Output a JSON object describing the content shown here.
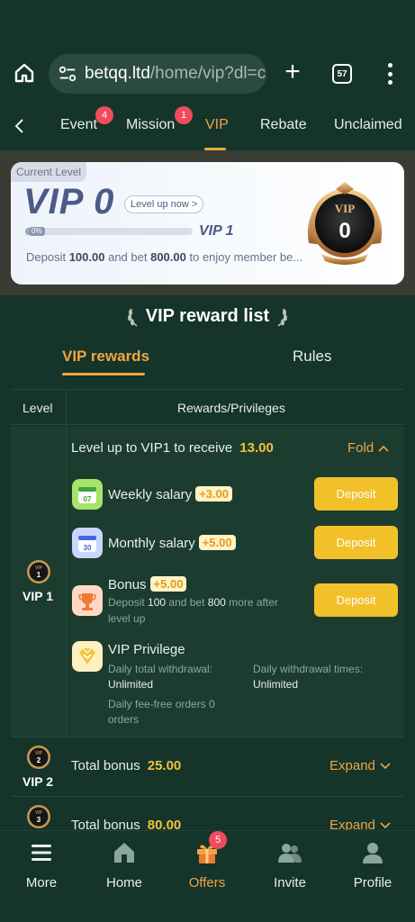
{
  "browser": {
    "url_domain": "betqq.ltd",
    "url_path": "/home/vip?dl=c",
    "tab_count": "57"
  },
  "nav": {
    "tabs": [
      {
        "label": "Event",
        "badge": "4"
      },
      {
        "label": "Mission",
        "badge": "1"
      },
      {
        "label": "VIP",
        "badge": ""
      },
      {
        "label": "Rebate",
        "badge": ""
      },
      {
        "label": "Unclaimed",
        "badge": ""
      }
    ],
    "active_tab": "VIP"
  },
  "level_card": {
    "current_level_label": "Current Level",
    "current_vip": "VIP 0",
    "level_up_label": "Level up now >",
    "progress_label": "0%",
    "progress_fraction": 0,
    "next_vip": "VIP 1",
    "desc_prefix": "Deposit",
    "deposit_amount": "100.00",
    "desc_mid": "and bet",
    "bet_amount": "800.00",
    "desc_suffix": "to enjoy member be...",
    "medal_title": "VIP",
    "medal_number": "0"
  },
  "reward_list": {
    "title": "VIP reward list",
    "tabs": [
      "VIP rewards",
      "Rules"
    ],
    "active_tab": "VIP rewards",
    "col_level": "Level",
    "col_rewards": "Rewards/Privileges"
  },
  "vip1": {
    "level_label": "VIP 1",
    "badge_text": "1",
    "head_text": "Level up to VIP1 to receive",
    "head_amount": "13.00",
    "fold_label": "Fold",
    "weekly": {
      "label": "Weekly salary",
      "amount": "+3.00",
      "icon_text": "07",
      "button": "Deposit"
    },
    "monthly": {
      "label": "Monthly salary",
      "amount": "+5.00",
      "icon_text": "30",
      "button": "Deposit"
    },
    "bonus": {
      "label": "Bonus",
      "amount": "+5.00",
      "button": "Deposit",
      "desc_prefix": "Deposit",
      "deposit": "100",
      "desc_mid": "and bet",
      "bet": "800",
      "desc_suffix": "more after",
      "desc_line2": "level up"
    },
    "privilege": {
      "label": "VIP Privilege",
      "withdrawal_label": "Daily total withdrawal:",
      "withdrawal_value": "Unlimited",
      "times_label": "Daily withdrawal times:",
      "times_value": "Unlimited",
      "fee_free_line1": "Daily fee-free orders 0",
      "fee_free_line2": "orders"
    }
  },
  "vip2": {
    "level_label": "VIP 2",
    "badge_text": "2",
    "total_label": "Total bonus",
    "amount": "25.00",
    "expand_label": "Expand"
  },
  "vip3": {
    "level_label": "VIP 3",
    "badge_text": "3",
    "total_label": "Total bonus",
    "amount": "80.00",
    "expand_label": "Expand"
  },
  "bottom_nav": {
    "items": [
      "More",
      "Home",
      "Offers",
      "Invite",
      "Profile"
    ],
    "offers_badge": "5",
    "active": "Offers"
  },
  "colors": {
    "background": "#15342a",
    "accent": "#f0a545",
    "button": "#f2c12a",
    "amount": "#f0c23b",
    "badge": "#ef4b5c"
  }
}
